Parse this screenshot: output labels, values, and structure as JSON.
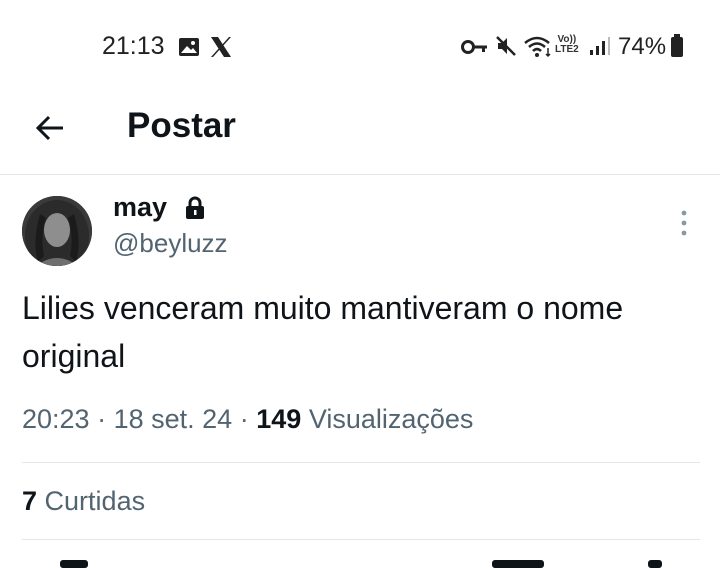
{
  "status_bar": {
    "time": "21:13",
    "battery_percent": "74%",
    "volte_label_top": "Vo))",
    "volte_label_bottom": "LTE2",
    "icons": [
      "image-icon",
      "x-logo-icon",
      "key-icon",
      "mute-icon",
      "wifi-icon",
      "signal-icon",
      "battery-icon"
    ]
  },
  "header": {
    "back_icon": "arrow-left-icon",
    "title": "Postar"
  },
  "post": {
    "author_name": "may",
    "author_handle": "@beyluzz",
    "protected_icon": "lock-icon",
    "text": "Lilies venceram muito mantiveram o nome original",
    "time": "20:23",
    "separator": "·",
    "date": "18 set. 24",
    "views_count": "149",
    "views_label": "Visualizações",
    "likes_count": "7",
    "likes_label": "Curtidas"
  },
  "colors": {
    "text_primary": "#0f1419",
    "text_secondary": "#536471",
    "divider": "#e6e6e6",
    "background": "#ffffff"
  }
}
